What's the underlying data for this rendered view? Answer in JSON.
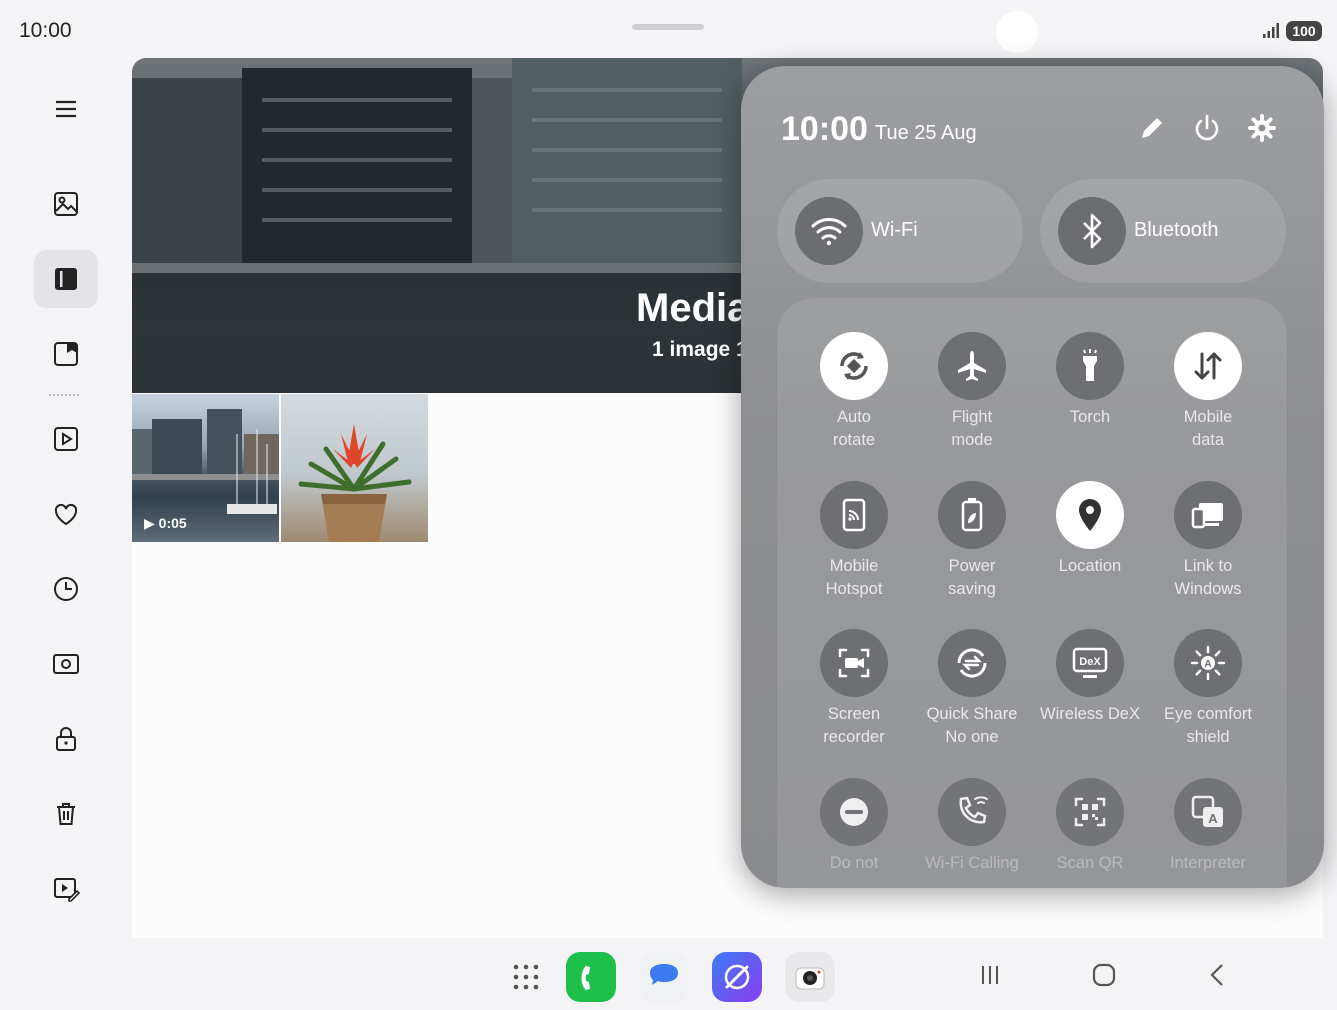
{
  "status_bar": {
    "time": "10:00",
    "battery": "100"
  },
  "nav_rail": {
    "items": [
      {
        "name": "menu-icon"
      },
      {
        "name": "pictures-icon"
      },
      {
        "name": "albums-icon",
        "active": true
      },
      {
        "name": "stories-icon"
      },
      {
        "name": "videos-icon"
      },
      {
        "name": "favourites-icon"
      },
      {
        "name": "recent-icon"
      },
      {
        "name": "screenshots-icon"
      },
      {
        "name": "secure-folder-icon"
      },
      {
        "name": "recycle-bin-icon"
      },
      {
        "name": "edit-video-icon"
      }
    ]
  },
  "album": {
    "title": "Media",
    "subtitle": "1 image 1",
    "thumbnails": [
      {
        "type": "video",
        "duration": "0:05"
      },
      {
        "type": "image"
      }
    ]
  },
  "quick_panel": {
    "time": "10:00",
    "date": "Tue 25 Aug",
    "header_icons": [
      "edit-icon",
      "power-icon",
      "settings-icon"
    ],
    "wide_tiles": [
      {
        "label": "Wi-Fi",
        "icon": "wifi-icon"
      },
      {
        "label": "Bluetooth",
        "icon": "bluetooth-icon"
      }
    ],
    "tiles": [
      {
        "line1": "Auto",
        "line2": "rotate",
        "icon": "auto-rotate-icon",
        "on": true
      },
      {
        "line1": "Flight",
        "line2": "mode",
        "icon": "airplane-icon",
        "on": false
      },
      {
        "line1": "Torch",
        "line2": "",
        "icon": "torch-icon",
        "on": false
      },
      {
        "line1": "Mobile",
        "line2": "data",
        "icon": "mobile-data-icon",
        "on": true
      },
      {
        "line1": "Mobile",
        "line2": "Hotspot",
        "icon": "hotspot-icon",
        "on": false
      },
      {
        "line1": "Power",
        "line2": "saving",
        "icon": "power-saving-icon",
        "on": false
      },
      {
        "line1": "Location",
        "line2": "",
        "icon": "location-icon",
        "on": true
      },
      {
        "line1": "Link to",
        "line2": "Windows",
        "icon": "link-windows-icon",
        "on": false
      },
      {
        "line1": "Screen",
        "line2": "recorder",
        "icon": "screen-recorder-icon",
        "on": false
      },
      {
        "line1": "Quick Share",
        "line2": "No one",
        "icon": "quick-share-icon",
        "on": false
      },
      {
        "line1": "Wireless DeX",
        "line2": "",
        "icon": "dex-icon",
        "on": false
      },
      {
        "line1": "Eye comfort",
        "line2": "shield",
        "icon": "eye-comfort-icon",
        "on": false
      },
      {
        "line1": "Do not",
        "line2": "",
        "icon": "do-not-disturb-icon",
        "on": false
      },
      {
        "line1": "Wi-Fi Calling",
        "line2": "",
        "icon": "wifi-calling-icon",
        "on": false
      },
      {
        "line1": "Scan QR",
        "line2": "",
        "icon": "scan-qr-icon",
        "on": false
      },
      {
        "line1": "Interpreter",
        "line2": "",
        "icon": "interpreter-icon",
        "on": false
      }
    ],
    "dex_label": "DeX"
  },
  "dock": {
    "apps": [
      "apps-grid-icon",
      "phone-app-icon",
      "messages-app-icon",
      "internet-app-icon",
      "camera-app-icon"
    ],
    "nav": [
      "recents-button",
      "home-button",
      "back-button"
    ]
  },
  "colors": {
    "accent_phone": "#1fbf4b",
    "accent_messages": "#3a7bf0",
    "accent_internet": "#6a4cf0"
  }
}
